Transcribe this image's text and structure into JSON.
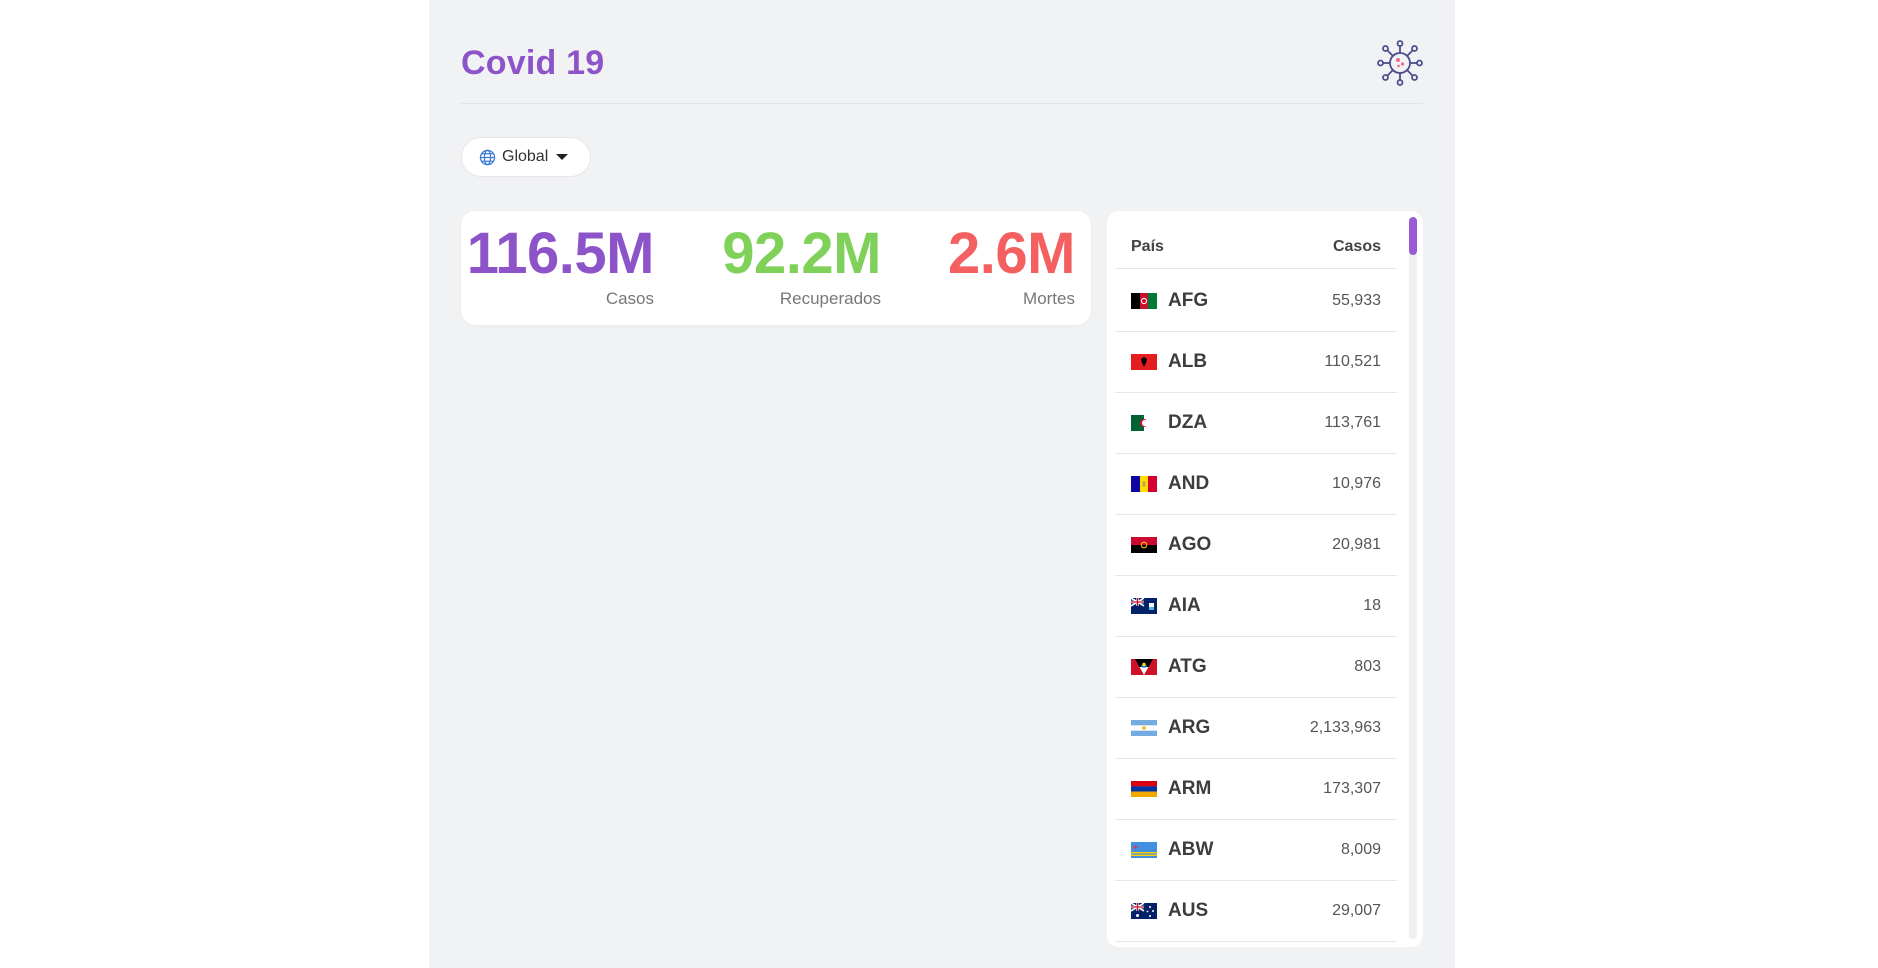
{
  "header": {
    "title": "Covid 19",
    "icon": "virus-icon"
  },
  "region_selector": {
    "value": "Global",
    "icon": "globe-icon"
  },
  "stats": [
    {
      "value": "116.5M",
      "label": "Casos",
      "color": "#8d54c9"
    },
    {
      "value": "92.2M",
      "label": "Recuperados",
      "color": "#7fd15a"
    },
    {
      "value": "2.6M",
      "label": "Mortes",
      "color": "#f45f5f"
    }
  ],
  "table": {
    "headers": {
      "country": "País",
      "cases": "Casos"
    },
    "rows": [
      {
        "code": "AFG",
        "cases": "55,933"
      },
      {
        "code": "ALB",
        "cases": "110,521"
      },
      {
        "code": "DZA",
        "cases": "113,761"
      },
      {
        "code": "AND",
        "cases": "10,976"
      },
      {
        "code": "AGO",
        "cases": "20,981"
      },
      {
        "code": "AIA",
        "cases": "18"
      },
      {
        "code": "ATG",
        "cases": "803"
      },
      {
        "code": "ARG",
        "cases": "2,133,963"
      },
      {
        "code": "ARM",
        "cases": "173,307"
      },
      {
        "code": "ABW",
        "cases": "8,009"
      },
      {
        "code": "AUS",
        "cases": "29,007"
      }
    ]
  },
  "colors": {
    "accent": "#8d54c9",
    "recovered": "#7fd15a",
    "deaths": "#f45f5f",
    "background": "#f1f2f4"
  }
}
